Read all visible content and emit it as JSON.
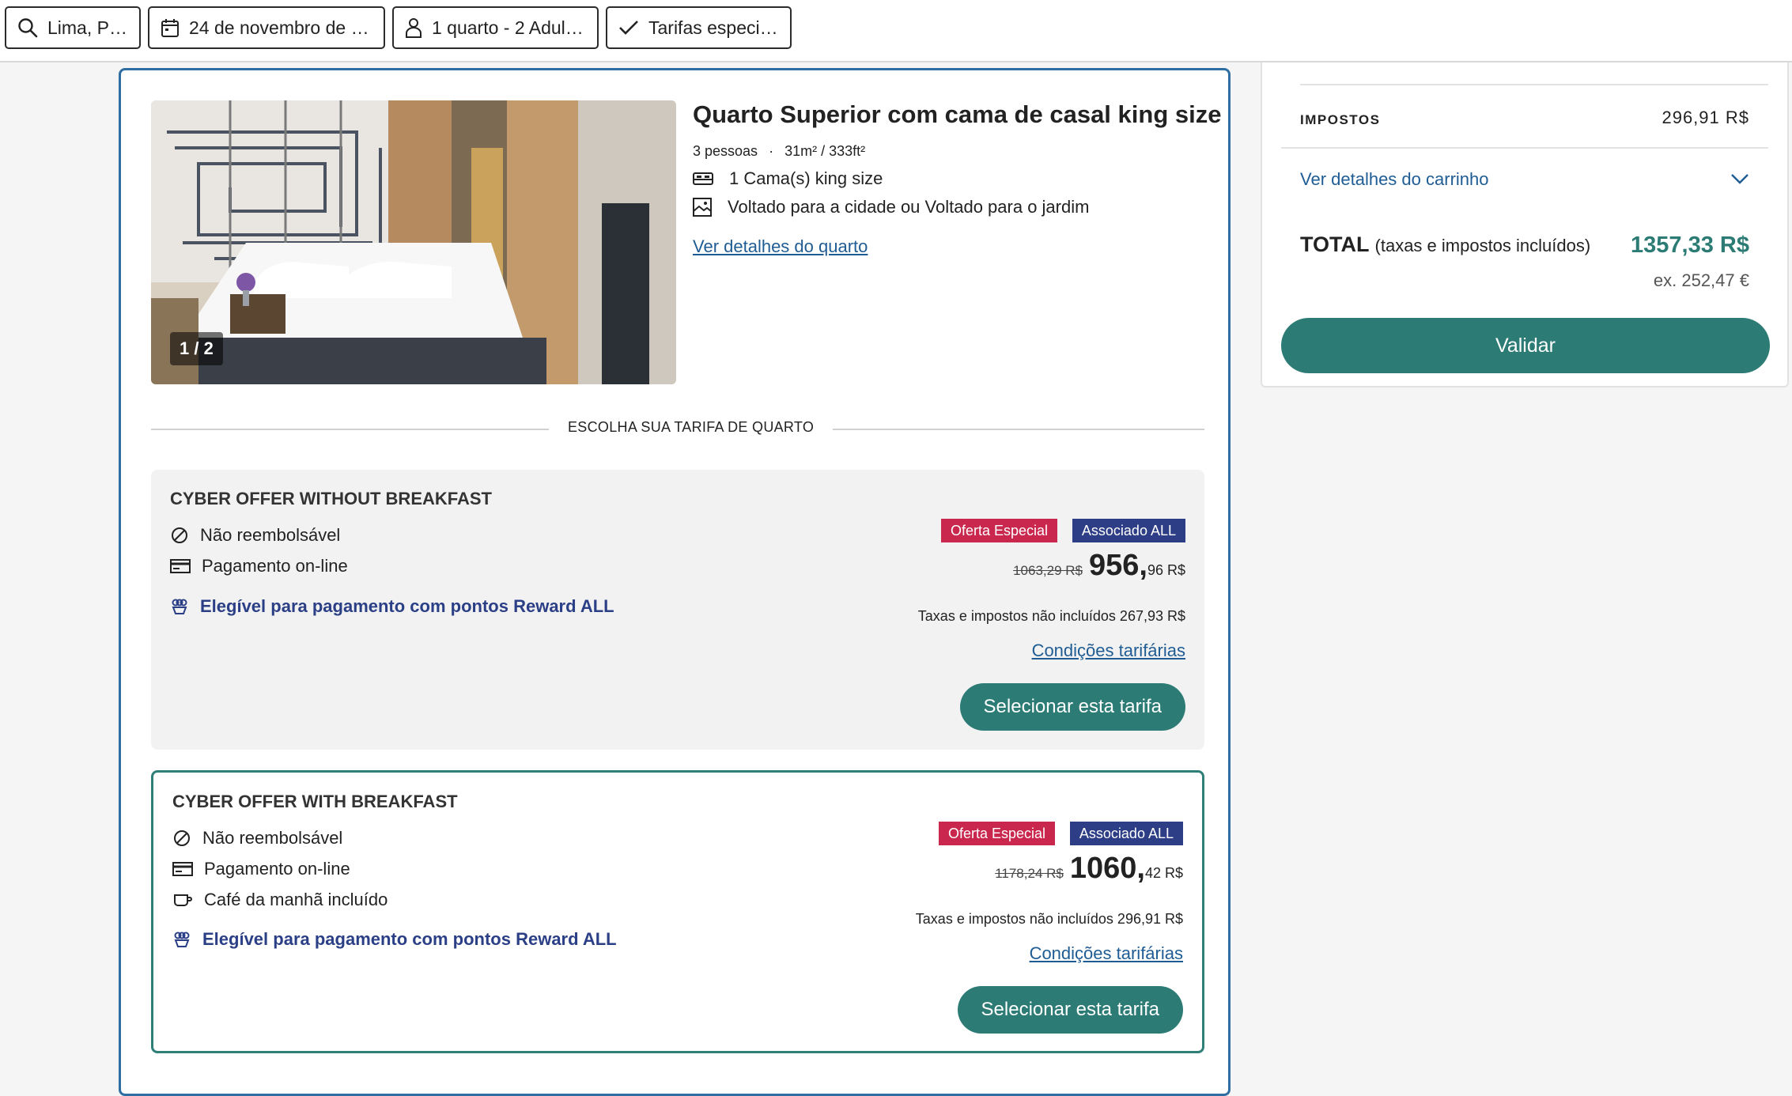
{
  "search": {
    "location": "Lima, Peru",
    "dates": "24 de novembro de 2...",
    "occupancy": "1 quarto - 2 Adultos",
    "special_rates": "Tarifas especiais"
  },
  "room": {
    "title": "Quarto Superior com cama de casal king size",
    "capacity": "3 pessoas",
    "separator": "·",
    "size": "31m² / 333ft²",
    "bed": "1 Cama(s) king size",
    "view": "Voltado para a cidade ou Voltado para o jardim",
    "details_link": "Ver detalhes do quarto",
    "image_counter": "1 / 2"
  },
  "rate_section_label": "ESCOLHA SUA TARIFA DE QUARTO",
  "rates": [
    {
      "title": "CYBER OFFER WITHOUT BREAKFAST",
      "non_refundable": "Não reembolsável",
      "payment": "Pagamento on-line",
      "reward": "Elegível para pagamento com pontos Reward ALL",
      "badge_special": "Oferta Especial",
      "badge_member": "Associado ALL",
      "old_price": "1063,29 R$",
      "price_main": "956,",
      "price_cents": "96 R$",
      "taxes": "Taxas e impostos não incluídos 267,93 R$",
      "conditions": "Condições tarifárias",
      "select": "Selecionar esta tarifa"
    },
    {
      "title": "CYBER OFFER WITH BREAKFAST",
      "non_refundable": "Não reembolsável",
      "payment": "Pagamento on-line",
      "breakfast": "Café da manhã incluído",
      "reward": "Elegível para pagamento com pontos Reward ALL",
      "badge_special": "Oferta Especial",
      "badge_member": "Associado ALL",
      "old_price": "1178,24 R$",
      "price_main": "1060,",
      "price_cents": "42 R$",
      "taxes": "Taxas e impostos não incluídos 296,91 R$",
      "conditions": "Condições tarifárias",
      "select": "Selecionar esta tarifa"
    }
  ],
  "summary": {
    "taxes_label": "IMPOSTOS",
    "taxes_value": "296,91 R$",
    "cart_link": "Ver detalhes do carrinho",
    "total_label": "TOTAL",
    "total_note": "(taxas e impostos incluídos)",
    "total_value": "1357,33 R$",
    "total_eur": "ex. 252,47 €",
    "validate": "Validar"
  },
  "colors": {
    "primary": "#2c7b75",
    "link": "#1f5c94",
    "badge_special": "#c9274d",
    "badge_member": "#2d3e86",
    "card_border": "#2f6ea3"
  }
}
